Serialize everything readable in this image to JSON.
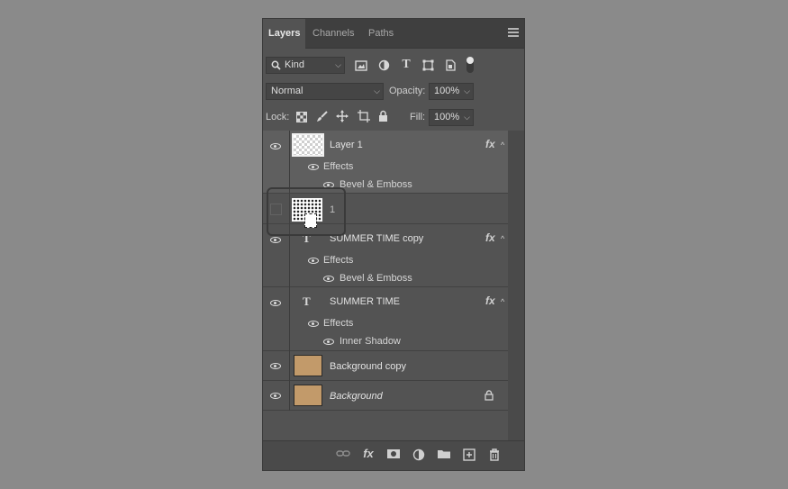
{
  "tabs": [
    {
      "label": "Layers"
    },
    {
      "label": "Channels"
    },
    {
      "label": "Paths"
    }
  ],
  "filter": {
    "kind_label": "Kind"
  },
  "blend": {
    "mode": "Normal",
    "opacity_label": "Opacity:",
    "opacity_value": "100%"
  },
  "lock": {
    "label": "Lock:",
    "fill_label": "Fill:",
    "fill_value": "100%"
  },
  "layers": [
    {
      "name": "Layer 1",
      "effects_label": "Effects",
      "effect": "Bevel & Emboss"
    },
    {
      "name": "1"
    },
    {
      "name": "SUMMER TIME copy",
      "effects_label": "Effects",
      "effect": "Bevel & Emboss"
    },
    {
      "name": "SUMMER TIME",
      "effects_label": "Effects",
      "effect": "Inner Shadow"
    },
    {
      "name": "Background copy"
    },
    {
      "name": "Background"
    }
  ],
  "icons": {
    "fx": "fx",
    "type": "T",
    "caret": "^"
  },
  "colors": {
    "panel": "#535353",
    "tabbar": "#3f3f3f",
    "selected_row": "#5f5f5f",
    "paper_thumb": "#c29a6a",
    "backdrop": "#8a8a8a"
  }
}
